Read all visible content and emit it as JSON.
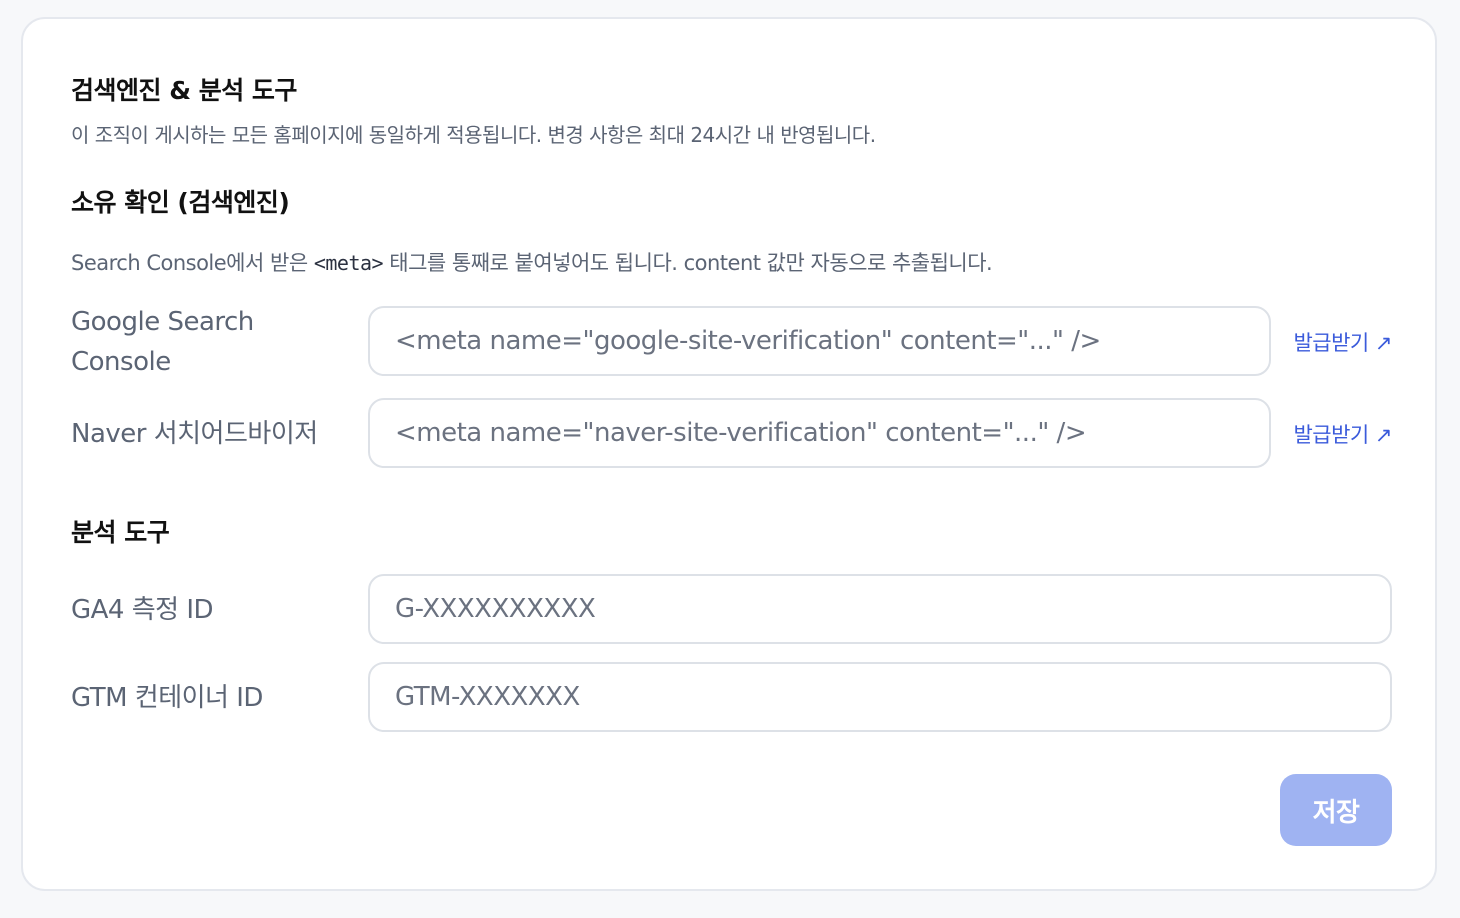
{
  "section": {
    "title": "검색엔진 & 분석 도구",
    "description": "이 조직이 게시하는 모든 홈페이지에 동일하게 적용됩니다. 변경 사항은 최대 24시간 내 반영됩니다."
  },
  "ownership": {
    "title": "소유 확인 (검색엔진)",
    "hint_before": "Search Console에서 받은 ",
    "hint_code": "<meta>",
    "hint_after": " 태그를 통째로 붙여넣어도 됩니다. content 값만 자동으로 추출됩니다.",
    "google": {
      "label": "Google Search Console",
      "placeholder": "<meta name=\"google-site-verification\" content=\"...\" />",
      "link": "발급받기 ↗"
    },
    "naver": {
      "label": "Naver 서치어드바이저",
      "placeholder": "<meta name=\"naver-site-verification\" content=\"...\" />",
      "link": "발급받기 ↗"
    }
  },
  "analytics": {
    "title": "분석 도구",
    "ga4": {
      "label": "GA4 측정 ID",
      "placeholder": "G-XXXXXXXXXX"
    },
    "gtm": {
      "label": "GTM 컨테이너 ID",
      "placeholder": "GTM-XXXXXXX"
    }
  },
  "actions": {
    "save_label": "저장"
  },
  "colors": {
    "accent": "#3b5bdb",
    "save_disabled": "#9fb3f2"
  }
}
